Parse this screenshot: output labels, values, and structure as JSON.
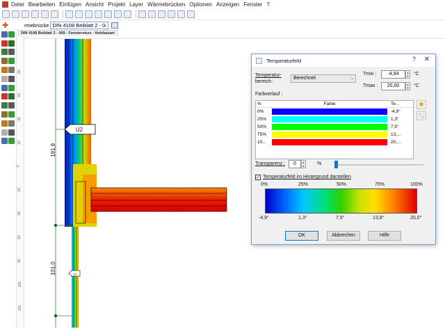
{
  "menu": [
    "Datei",
    "Bearbeiten",
    "Einfügen",
    "Ansicht",
    "Projekt",
    "Layer",
    "Wärmebrücken",
    "Optionen",
    "Anzeigen",
    "Fenster",
    "?"
  ],
  "toolbar2": {
    "label": "rmebrücke",
    "catalog_value": "DIN 4108 Beiblatt 2 - 0"
  },
  "tab": {
    "label": "DIN 4108 Beiblatt 2 - 069 - Fenstersturz - Holzbauart"
  },
  "ruler_marks": [
    "80",
    "60",
    "40",
    "20",
    "0",
    "20",
    "40",
    "60",
    "80",
    "100",
    "120"
  ],
  "drawing": {
    "dim_upper": "191,9",
    "dim_lower": "101,0",
    "marker_upper": "U2",
    "marker_lower": "U1"
  },
  "dialog": {
    "title": "Temperaturfeld",
    "help_btn": "?",
    "close_btn": "✕",
    "range_label": "Temperatur-\nbereich :",
    "range_label_1": "Temperatur-",
    "range_label_2": "bereich :",
    "range_value": "Berechnet",
    "tmin_label": "Tmin :",
    "tmin_value": "-4,94",
    "tmax_label": "Tmax :",
    "tmax_value": "20,00",
    "unit": "°C",
    "gradient_label": "Farbverlauf :",
    "table": {
      "headers": [
        "%",
        "Farbe",
        "Te..."
      ],
      "rows": [
        {
          "pct": "0%",
          "color": "#0a00ff",
          "temp": "-4,9°"
        },
        {
          "pct": "25%",
          "color": "#00ffff",
          "temp": "1,3°"
        },
        {
          "pct": "50%",
          "color": "#00ff00",
          "temp": "7,5°"
        },
        {
          "pct": "75%",
          "color": "#ffff00",
          "temp": "13,..."
        },
        {
          "pct": "10...",
          "color": "#ff0000",
          "temp": "20,..."
        }
      ]
    },
    "transparency_label": "Transparenz :",
    "transparency_value": "0",
    "transparency_unit": "%",
    "transparency_level": 0,
    "background_checkbox_label": "Temperaturfeld im Hintergrund darstellen",
    "background_checked": true,
    "scale_pct": [
      "0%",
      "25%",
      "50%",
      "75%",
      "100%"
    ],
    "scale_temp": [
      "-4,9°",
      "1,3°",
      "7,5°",
      "13,8°",
      "20,0°"
    ],
    "ok": "OK",
    "cancel": "Abbrechen",
    "help": "Hilfe"
  },
  "colors": {
    "accent": "#0078d7",
    "dim_line": "#2e8b2e"
  }
}
